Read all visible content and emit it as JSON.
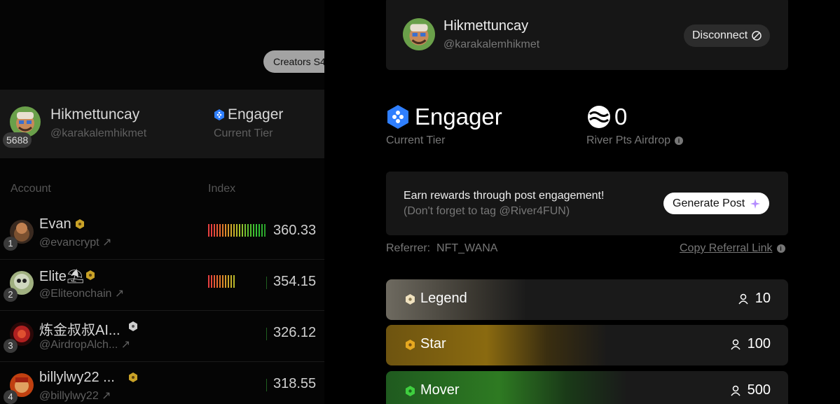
{
  "left": {
    "creators_pill": "Creators S4",
    "user": {
      "name": "Hikmettuncay",
      "handle": "@karakalemhikmet",
      "badge": "5688",
      "tier": "Engager",
      "tier_label": "Current Tier"
    },
    "columns": {
      "account": "Account",
      "index": "Index"
    },
    "rows": [
      {
        "rank": "1",
        "name": "Evan",
        "handle": "@evancrypt",
        "value": "360.33",
        "hex_color": "#c9a227"
      },
      {
        "rank": "2",
        "name": "Elite⛱",
        "handle": "@Eliteonchain",
        "value": "354.15",
        "hex_color": "#c9a227"
      },
      {
        "rank": "3",
        "name": "炼金叔叔AI...",
        "handle": "@AirdropAlch...",
        "value": "326.12",
        "hex_color": "#cfcfcf"
      },
      {
        "rank": "4",
        "name": "billylwy22 ...",
        "handle": "@billylwy22",
        "value": "318.55",
        "hex_color": "#c9a227"
      }
    ]
  },
  "right": {
    "profile": {
      "name": "Hikmettuncay",
      "handle": "@karakalemhikmet",
      "disconnect_label": "Disconnect"
    },
    "tier": {
      "name": "Engager",
      "label": "Current Tier"
    },
    "points": {
      "value": "0",
      "label": "River Pts Airdrop"
    },
    "earn": {
      "line1": "Earn rewards through post engagement!",
      "line2": "(Don't forget to tag @River4FUN)",
      "button": "Generate Post"
    },
    "referrer": "Referrer:  NFT_WANA",
    "copy_link": "Copy Referral Link",
    "tiers": [
      {
        "name": "Legend",
        "count": "10",
        "color": "#f0e2c0"
      },
      {
        "name": "Star",
        "count": "100",
        "color": "#e6a820"
      },
      {
        "name": "Mover",
        "count": "500",
        "color": "#3fcf3f"
      }
    ]
  },
  "colors": {
    "accent_blue": "#2f7fff",
    "bg": "#000000",
    "card": "#161616"
  }
}
